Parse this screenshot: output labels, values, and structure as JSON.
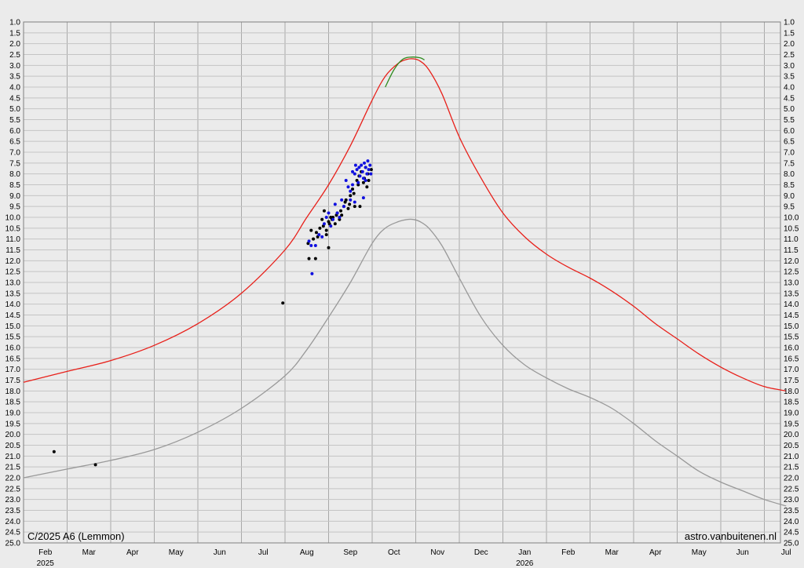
{
  "chart_data": {
    "type": "line",
    "title": "C/2025 A6 (Lemmon)",
    "credit": "astro.vanbuitenen.nl",
    "ylim": [
      25.0,
      1.0
    ],
    "y_inverted": true,
    "y_tick_labels": [
      "1.0",
      "1.5",
      "2.0",
      "2.5",
      "3.0",
      "3.5",
      "4.0",
      "4.5",
      "5.0",
      "5.5",
      "6.0",
      "6.5",
      "7.0",
      "7.5",
      "8.0",
      "8.5",
      "9.0",
      "9.5",
      "10.0",
      "10.5",
      "11.0",
      "11.5",
      "12.0",
      "12.5",
      "13.0",
      "13.5",
      "14.0",
      "14.5",
      "15.0",
      "15.5",
      "16.0",
      "16.5",
      "17.0",
      "17.5",
      "18.0",
      "18.5",
      "19.0",
      "19.5",
      "20.0",
      "20.5",
      "21.0",
      "21.5",
      "22.0",
      "22.5",
      "23.0",
      "23.5",
      "24.0",
      "24.5",
      "25.0"
    ],
    "x_months": [
      "Feb",
      "Mar",
      "Apr",
      "May",
      "Jun",
      "Jul",
      "Aug",
      "Sep",
      "Oct",
      "Nov",
      "Dec",
      "Jan",
      "Feb",
      "Mar",
      "Apr",
      "May",
      "Jun",
      "Jul"
    ],
    "x_years": [
      {
        "label": "2025",
        "month_index": 0
      },
      {
        "label": "2026",
        "month_index": 11
      }
    ],
    "grid": true,
    "series": [
      {
        "color": "#e8201a",
        "x": [
          0,
          1,
          2,
          3,
          4,
          5,
          6,
          6.5,
          7,
          7.5,
          8,
          8.3,
          8.6,
          8.8,
          8.95,
          9.1,
          9.3,
          9.6,
          10,
          10.5,
          11,
          11.5,
          12,
          12.5,
          13,
          13.5,
          14,
          14.5,
          15,
          15.5,
          16,
          16.5,
          17,
          17.5
        ],
        "y": [
          17.6,
          17.1,
          16.6,
          15.9,
          14.9,
          13.5,
          11.5,
          10.0,
          8.5,
          6.7,
          4.6,
          3.5,
          2.9,
          2.72,
          2.7,
          2.8,
          3.2,
          4.3,
          6.3,
          8.2,
          9.8,
          10.9,
          11.7,
          12.3,
          12.8,
          13.4,
          14.1,
          14.9,
          15.6,
          16.3,
          16.9,
          17.4,
          17.8,
          18.0
        ]
      },
      {
        "color": "#2e8b1f",
        "x": [
          8.3,
          8.5,
          8.7,
          8.9,
          9.1,
          9.2
        ],
        "y": [
          4.0,
          3.2,
          2.72,
          2.62,
          2.65,
          2.75
        ]
      },
      {
        "color": "#999999",
        "x": [
          0,
          1,
          2,
          3,
          4,
          5,
          6,
          6.5,
          7,
          7.5,
          8,
          8.3,
          8.6,
          8.8,
          8.95,
          9.1,
          9.3,
          9.6,
          10,
          10.5,
          11,
          11.5,
          12,
          12.5,
          13,
          13.5,
          14,
          14.5,
          15,
          15.5,
          16,
          16.5,
          17,
          17.5
        ],
        "y": [
          22.0,
          21.6,
          21.2,
          20.7,
          19.9,
          18.8,
          17.3,
          16.1,
          14.6,
          13.0,
          11.2,
          10.5,
          10.2,
          10.1,
          10.1,
          10.2,
          10.5,
          11.3,
          12.8,
          14.6,
          15.9,
          16.8,
          17.4,
          17.9,
          18.3,
          18.8,
          19.5,
          20.3,
          21.0,
          21.7,
          22.2,
          22.6,
          23.0,
          23.3
        ]
      }
    ],
    "observations": [
      {
        "color": "#000000",
        "points": [
          [
            0.7,
            20.8
          ],
          [
            1.65,
            21.4
          ],
          [
            5.95,
            13.95
          ],
          [
            6.55,
            11.9
          ],
          [
            6.53,
            11.2
          ],
          [
            6.7,
            11.9
          ],
          [
            6.6,
            10.6
          ],
          [
            6.75,
            10.9
          ],
          [
            6.8,
            10.5
          ],
          [
            6.85,
            10.1
          ],
          [
            6.9,
            9.7
          ],
          [
            6.95,
            10.8
          ],
          [
            7.0,
            11.4
          ],
          [
            7.0,
            10.2
          ],
          [
            7.05,
            10.0
          ],
          [
            7.1,
            10.0
          ],
          [
            7.15,
            10.3
          ],
          [
            7.2,
            9.8
          ],
          [
            7.25,
            10.1
          ],
          [
            7.3,
            9.9
          ],
          [
            7.35,
            9.5
          ],
          [
            7.4,
            9.2
          ],
          [
            7.45,
            9.6
          ],
          [
            7.5,
            9.0
          ],
          [
            7.55,
            8.7
          ],
          [
            7.6,
            9.5
          ],
          [
            7.65,
            8.3
          ],
          [
            7.7,
            8.1
          ],
          [
            7.75,
            7.9
          ],
          [
            7.8,
            8.4
          ],
          [
            7.85,
            7.7
          ],
          [
            7.9,
            8.0
          ],
          [
            7.92,
            8.3
          ],
          [
            7.98,
            7.8
          ],
          [
            6.65,
            11.0
          ],
          [
            6.72,
            10.7
          ],
          [
            6.88,
            10.4
          ],
          [
            6.95,
            10.6
          ],
          [
            7.02,
            10.3
          ],
          [
            7.08,
            10.1
          ],
          [
            7.18,
            9.9
          ],
          [
            7.28,
            9.7
          ],
          [
            7.38,
            9.3
          ],
          [
            7.48,
            9.4
          ],
          [
            7.58,
            8.9
          ],
          [
            7.68,
            8.5
          ],
          [
            7.72,
            9.5
          ],
          [
            7.82,
            8.2
          ],
          [
            7.88,
            8.6
          ]
        ]
      },
      {
        "color": "#1010e0",
        "points": [
          [
            6.62,
            12.6
          ],
          [
            6.55,
            11.1
          ],
          [
            6.6,
            11.3
          ],
          [
            6.7,
            11.3
          ],
          [
            6.78,
            10.8
          ],
          [
            6.85,
            10.9
          ],
          [
            6.9,
            10.3
          ],
          [
            6.95,
            10.0
          ],
          [
            7.0,
            9.8
          ],
          [
            7.05,
            10.4
          ],
          [
            7.1,
            10.1
          ],
          [
            7.15,
            9.4
          ],
          [
            7.2,
            9.8
          ],
          [
            7.25,
            10.0
          ],
          [
            7.3,
            9.2
          ],
          [
            7.35,
            9.5
          ],
          [
            7.4,
            8.3
          ],
          [
            7.45,
            8.6
          ],
          [
            7.5,
            8.8
          ],
          [
            7.55,
            8.5
          ],
          [
            7.6,
            8.0
          ],
          [
            7.62,
            7.6
          ],
          [
            7.65,
            7.8
          ],
          [
            7.68,
            8.4
          ],
          [
            7.7,
            7.7
          ],
          [
            7.72,
            8.1
          ],
          [
            7.75,
            7.6
          ],
          [
            7.78,
            7.9
          ],
          [
            7.8,
            8.2
          ],
          [
            7.82,
            7.5
          ],
          [
            7.85,
            7.7
          ],
          [
            7.88,
            8.0
          ],
          [
            7.9,
            7.4
          ],
          [
            7.92,
            7.8
          ],
          [
            7.95,
            7.6
          ],
          [
            7.97,
            8.0
          ],
          [
            7.8,
            9.1
          ],
          [
            7.85,
            8.3
          ],
          [
            7.6,
            9.3
          ],
          [
            7.5,
            9.2
          ],
          [
            7.55,
            7.9
          ]
        ]
      }
    ]
  }
}
